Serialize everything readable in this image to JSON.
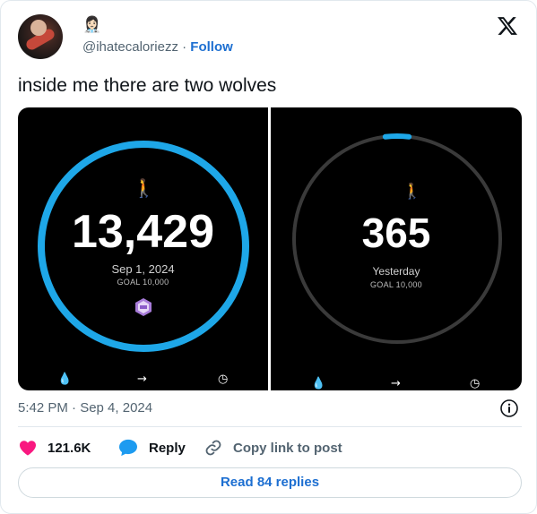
{
  "header": {
    "status_emoji": "👩🏻‍⚕️",
    "handle": "@ihatecaloriezz",
    "separator": "·",
    "follow_label": "Follow"
  },
  "tweet": {
    "text": "inside me there are two wolves"
  },
  "media": {
    "left_panel": {
      "steps": "13,429",
      "date": "Sep 1, 2024",
      "goal": "GOAL 10,000",
      "ring_color": "#1ea7e8",
      "progress": 1.0
    },
    "right_panel": {
      "steps": "365",
      "date": "Yesterday",
      "goal": "GOAL 10,000",
      "ring_color": "#1ea7e8",
      "progress": 0.0365
    },
    "walker_glyph": "🚶",
    "bottom_icons": [
      "flame-icon",
      "arrow-right-icon",
      "clock-icon"
    ]
  },
  "meta": {
    "timestamp": "5:42 PM · Sep 4, 2024"
  },
  "actions": {
    "likes": "121.6K",
    "reply_label": "Reply",
    "copy_label": "Copy link to post"
  },
  "read_replies_label": "Read 84 replies",
  "colors": {
    "accent": "#1d6fd1",
    "heart": "#f91880",
    "reply": "#1d9bf0",
    "ring_track": "#3a3a3a"
  }
}
